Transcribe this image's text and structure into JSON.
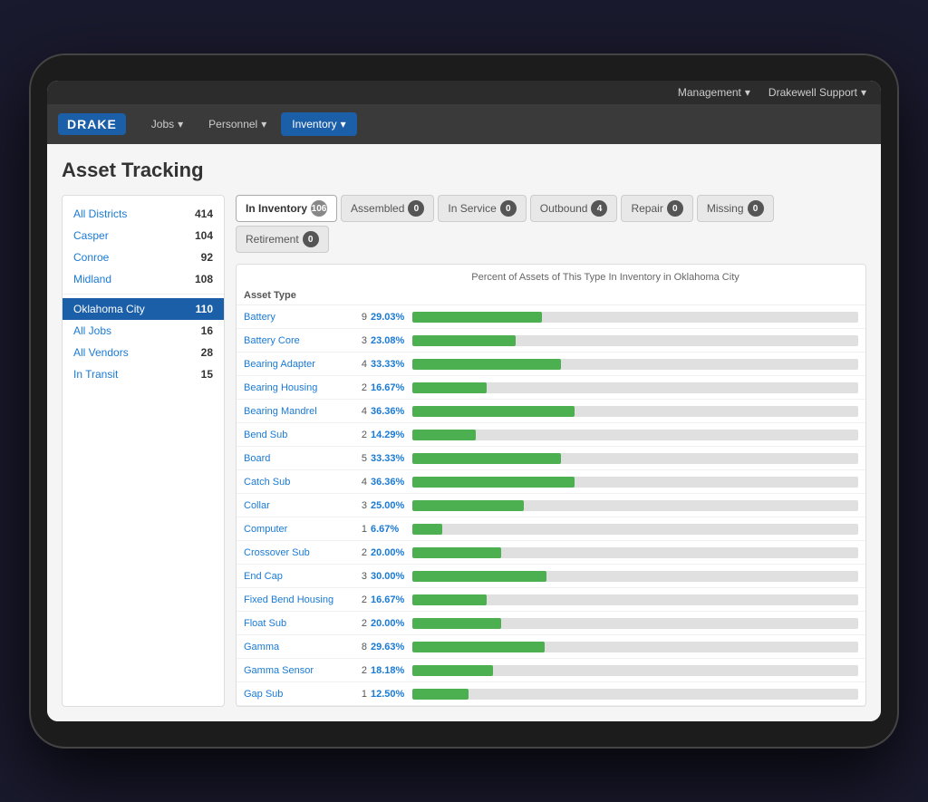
{
  "topNav": {
    "items": [
      {
        "label": "Management",
        "id": "management"
      },
      {
        "label": "Drakewell Support",
        "id": "drakewell-support"
      }
    ]
  },
  "mainNav": {
    "logo": "DRAKE",
    "items": [
      {
        "label": "Jobs",
        "id": "jobs",
        "active": false
      },
      {
        "label": "Personnel",
        "id": "personnel",
        "active": false
      },
      {
        "label": "Inventory",
        "id": "inventory",
        "active": true
      }
    ]
  },
  "pageTitle": "Asset Tracking",
  "sidebar": {
    "items": [
      {
        "label": "All Districts",
        "count": "414",
        "active": false
      },
      {
        "label": "Casper",
        "count": "104",
        "active": false
      },
      {
        "label": "Conroe",
        "count": "92",
        "active": false
      },
      {
        "label": "Midland",
        "count": "108",
        "active": false
      },
      {
        "label": "Oklahoma City",
        "count": "110",
        "active": true
      },
      {
        "label": "All Jobs",
        "count": "16",
        "active": false
      },
      {
        "label": "All Vendors",
        "count": "28",
        "active": false
      },
      {
        "label": "In Transit",
        "count": "15",
        "active": false
      }
    ]
  },
  "tabs": [
    {
      "label": "In Inventory",
      "count": "106",
      "active": true,
      "badgeBlue": true
    },
    {
      "label": "Assembled",
      "count": "0",
      "active": false
    },
    {
      "label": "In Service",
      "count": "0",
      "active": false
    },
    {
      "label": "Outbound",
      "count": "4",
      "active": false
    },
    {
      "label": "Repair",
      "count": "0",
      "active": false
    },
    {
      "label": "Missing",
      "count": "0",
      "active": false
    },
    {
      "label": "Retirement",
      "count": "0",
      "active": false
    }
  ],
  "chartTitle": "Percent of Assets of This Type In Inventory in Oklahoma City",
  "columnHeaders": {
    "assetType": "Asset Type"
  },
  "rows": [
    {
      "name": "Battery",
      "count": "9",
      "pct": "29.03%",
      "pctNum": 29.03
    },
    {
      "name": "Battery Core",
      "count": "3",
      "pct": "23.08%",
      "pctNum": 23.08
    },
    {
      "name": "Bearing Adapter",
      "count": "4",
      "pct": "33.33%",
      "pctNum": 33.33
    },
    {
      "name": "Bearing Housing",
      "count": "2",
      "pct": "16.67%",
      "pctNum": 16.67
    },
    {
      "name": "Bearing Mandrel",
      "count": "4",
      "pct": "36.36%",
      "pctNum": 36.36
    },
    {
      "name": "Bend Sub",
      "count": "2",
      "pct": "14.29%",
      "pctNum": 14.29
    },
    {
      "name": "Board",
      "count": "5",
      "pct": "33.33%",
      "pctNum": 33.33
    },
    {
      "name": "Catch Sub",
      "count": "4",
      "pct": "36.36%",
      "pctNum": 36.36
    },
    {
      "name": "Collar",
      "count": "3",
      "pct": "25.00%",
      "pctNum": 25.0
    },
    {
      "name": "Computer",
      "count": "1",
      "pct": "6.67%",
      "pctNum": 6.67
    },
    {
      "name": "Crossover Sub",
      "count": "2",
      "pct": "20.00%",
      "pctNum": 20.0
    },
    {
      "name": "End Cap",
      "count": "3",
      "pct": "30.00%",
      "pctNum": 30.0
    },
    {
      "name": "Fixed Bend Housing",
      "count": "2",
      "pct": "16.67%",
      "pctNum": 16.67
    },
    {
      "name": "Float Sub",
      "count": "2",
      "pct": "20.00%",
      "pctNum": 20.0
    },
    {
      "name": "Gamma",
      "count": "8",
      "pct": "29.63%",
      "pctNum": 29.63
    },
    {
      "name": "Gamma Sensor",
      "count": "2",
      "pct": "18.18%",
      "pctNum": 18.18
    },
    {
      "name": "Gap Sub",
      "count": "1",
      "pct": "12.50%",
      "pctNum": 12.5
    }
  ]
}
